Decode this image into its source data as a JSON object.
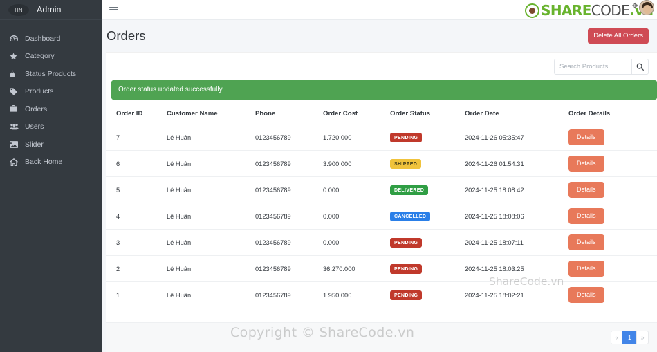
{
  "sidebar": {
    "brand_logo_text": "HN",
    "brand_title": "Admin",
    "items": [
      {
        "label": "Dashboard",
        "icon": "tachometer-icon"
      },
      {
        "label": "Category",
        "icon": "star-icon"
      },
      {
        "label": "Status Products",
        "icon": "fire-icon"
      },
      {
        "label": "Products",
        "icon": "tag-icon"
      },
      {
        "label": "Orders",
        "icon": "briefcase-icon"
      },
      {
        "label": "Users",
        "icon": "users-icon"
      },
      {
        "label": "Slider",
        "icon": "image-icon"
      },
      {
        "label": "Back Home",
        "icon": "home-icon"
      }
    ]
  },
  "topbar": {
    "menu_icon": "hamburger-icon"
  },
  "page": {
    "title": "Orders",
    "delete_all_label": "Delete All Orders"
  },
  "search": {
    "placeholder": "Search Products",
    "value": "",
    "icon": "search-icon"
  },
  "alert": {
    "message": "Order status updated successfully",
    "color": "#4fa352"
  },
  "table": {
    "headers": [
      "Order ID",
      "Customer Name",
      "Phone",
      "Order Cost",
      "Order Status",
      "Order Date",
      "Order Details"
    ],
    "details_label": "Details",
    "rows": [
      {
        "order_id": "7",
        "customer_name": "Lê Huân",
        "phone": "0123456789",
        "order_cost": "1.720.000",
        "status": "PENDING",
        "status_class": "badge-pending",
        "order_date": "2024-11-26 05:35:47",
        "details_label": "Details"
      },
      {
        "order_id": "6",
        "customer_name": "Lê Huân",
        "phone": "0123456789",
        "order_cost": "3.900.000",
        "status": "SHIPPED",
        "status_class": "badge-shipped",
        "order_date": "2024-11-26 01:54:31",
        "details_label": "Details"
      },
      {
        "order_id": "5",
        "customer_name": "Lê Huân",
        "phone": "0123456789",
        "order_cost": "0.000",
        "status": "DELIVERED",
        "status_class": "badge-delivered",
        "order_date": "2024-11-25 18:08:42",
        "details_label": "Details"
      },
      {
        "order_id": "4",
        "customer_name": "Lê Huân",
        "phone": "0123456789",
        "order_cost": "0.000",
        "status": "CANCELLED",
        "status_class": "badge-cancelled",
        "order_date": "2024-11-25 18:08:06",
        "details_label": "Details"
      },
      {
        "order_id": "3",
        "customer_name": "Lê Huân",
        "phone": "0123456789",
        "order_cost": "0.000",
        "status": "PENDING",
        "status_class": "badge-pending",
        "order_date": "2024-11-25 18:07:11",
        "details_label": "Details"
      },
      {
        "order_id": "2",
        "customer_name": "Lê Huân",
        "phone": "0123456789",
        "order_cost": "36.270.000",
        "status": "PENDING",
        "status_class": "badge-pending",
        "order_date": "2024-11-25 18:03:25",
        "details_label": "Details"
      },
      {
        "order_id": "1",
        "customer_name": "Lê Huân",
        "phone": "0123456789",
        "order_cost": "1.950.000",
        "status": "PENDING",
        "status_class": "badge-pending",
        "order_date": "2024-11-25 18:02:21",
        "details_label": "Details"
      }
    ]
  },
  "pagination": {
    "prev_label": "«",
    "next_label": "»",
    "pages": [
      "1"
    ],
    "active_page": "1",
    "active_color": "#4285e8"
  },
  "watermarks": {
    "copyright": "Copyright © ShareCode.vn",
    "table_overlay": "ShareCode.vn",
    "logo_share": "SHARE",
    "logo_code": "CODE",
    "logo_vn": ".vn"
  },
  "colors": {
    "sidebar_bg": "#343a40",
    "danger": "#cf4b55",
    "details_btn": "#e8795a",
    "badge_pending": "#c0392b",
    "badge_shipped": "#f0c33c",
    "badge_delivered": "#2f9e44",
    "badge_cancelled": "#2a7fe8"
  }
}
